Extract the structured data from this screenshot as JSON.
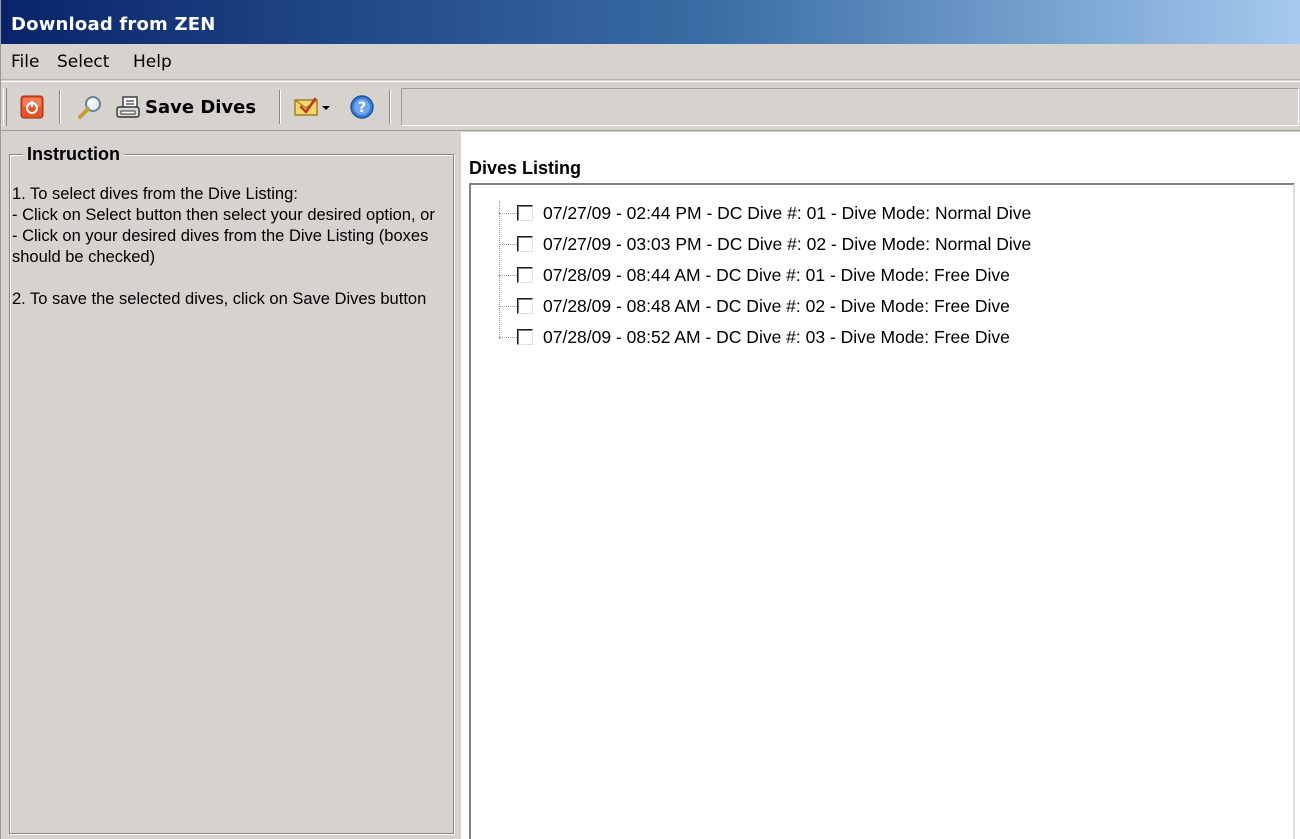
{
  "window": {
    "title": "Download from ZEN"
  },
  "menu": {
    "items": [
      "File",
      "Select",
      "Help"
    ]
  },
  "toolbar": {
    "save_label": "Save Dives",
    "icons": [
      "power-icon",
      "search-icon",
      "save-icon",
      "select-dropdown-icon",
      "help-icon"
    ]
  },
  "instruction": {
    "title": "Instruction",
    "lines": [
      "1. To select dives from the Dive Listing:",
      "- Click on Select button then select your desired option, or",
      "- Click on your desired dives from the Dive Listing (boxes should be checked)",
      "",
      "2. To save the selected dives, click on Save Dives button"
    ]
  },
  "dives": {
    "heading": "Dives Listing",
    "items": [
      {
        "label": "07/27/09 - 02:44 PM - DC Dive #: 01 - Dive Mode: Normal Dive",
        "checked": false
      },
      {
        "label": "07/27/09 - 03:03 PM - DC Dive #: 02 - Dive Mode: Normal Dive",
        "checked": false
      },
      {
        "label": "07/28/09 - 08:44 AM - DC Dive #: 01 - Dive Mode: Free Dive",
        "checked": false
      },
      {
        "label": "07/28/09 - 08:48 AM - DC Dive #: 02 - Dive Mode: Free Dive",
        "checked": false
      },
      {
        "label": "07/28/09 - 08:52 AM - DC Dive #: 03 - Dive Mode: Free Dive",
        "checked": false
      }
    ]
  },
  "colors": {
    "title_gradient_start": "#0a246a",
    "title_gradient_end": "#a6caf0",
    "panel_bg": "#d6d3ce",
    "list_bg": "#ffffff"
  }
}
